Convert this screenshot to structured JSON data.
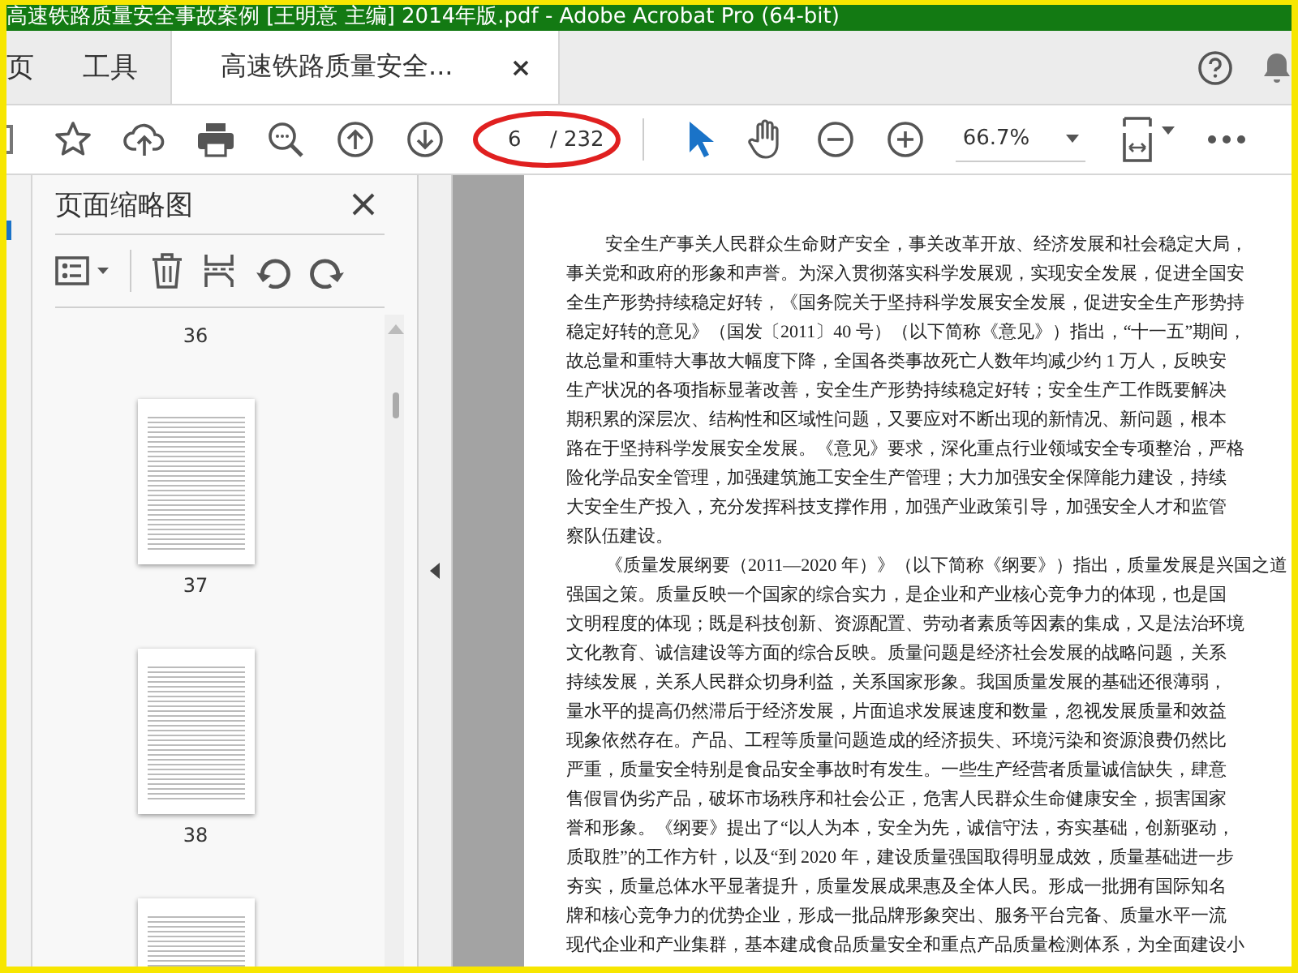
{
  "window": {
    "title": "高速铁路质量安全事故案例 [王明意 主编] 2014年版.pdf - Adobe Acrobat Pro (64-bit)"
  },
  "tabs": [
    {
      "label": "页",
      "kind": "nav",
      "selected": false
    },
    {
      "label": "工具",
      "kind": "nav",
      "selected": false
    },
    {
      "label": "高速铁路质量安全...",
      "kind": "document",
      "selected": true
    }
  ],
  "toolbar": {
    "page_field": {
      "value": "6",
      "total": "/ 232"
    },
    "tools": [
      {
        "kind": "select",
        "selected": true
      },
      {
        "kind": "hand",
        "selected": false
      }
    ],
    "zoom": {
      "value": "66.7%"
    }
  },
  "sidebar": {
    "title": "页面缩略图",
    "thumbnails": [
      {
        "label": "36"
      },
      {
        "label": "37"
      },
      {
        "label": "38"
      }
    ]
  },
  "document": {
    "paragraphs": [
      {
        "lines": [
          "安全生产事关人民群众生命财产安全，事关改革开放、经济发展和社会稳定大局，",
          "事关党和政府的形象和声誉。为深入贯彻落实科学发展观，实现安全发展，促进全国安",
          "全生产形势持续稳定好转，《国务院关于坚持科学发展安全发展，促进安全生产形势持",
          "稳定好转的意见》（国发〔2011〕40 号）（以下简称《意见》）指出，“十一五”期间，",
          "故总量和重特大事故大幅度下降，全国各类事故死亡人数年均减少约 1 万人，反映安",
          "生产状况的各项指标显著改善，安全生产形势持续稳定好转；安全生产工作既要解决",
          "期积累的深层次、结构性和区域性问题，又要应对不断出现的新情况、新问题，根本",
          "路在于坚持科学发展安全发展。《意见》要求，深化重点行业领域安全专项整治，严格",
          "险化学品安全管理，加强建筑施工安全生产管理；大力加强安全保障能力建设，持续",
          "大安全生产投入，充分发挥科技支撑作用，加强产业政策引导，加强安全人才和监管",
          "察队伍建设。"
        ]
      },
      {
        "lines": [
          "《质量发展纲要（2011—2020 年）》（以下简称《纲要》）指出，质量发展是兴国之道",
          "强国之策。质量反映一个国家的综合实力，是企业和产业核心竞争力的体现，也是国",
          "文明程度的体现；既是科技创新、资源配置、劳动者素质等因素的集成，又是法治环境",
          "文化教育、诚信建设等方面的综合反映。质量问题是经济社会发展的战略问题，关系",
          "持续发展，关系人民群众切身利益，关系国家形象。我国质量发展的基础还很薄弱，",
          "量水平的提高仍然滞后于经济发展，片面追求发展速度和数量，忽视发展质量和效益",
          "现象依然存在。产品、工程等质量问题造成的经济损失、环境污染和资源浪费仍然比",
          "严重，质量安全特别是食品安全事故时有发生。一些生产经营者质量诚信缺失，肆意",
          "售假冒伪劣产品，破坏市场秩序和社会公正，危害人民群众生命健康安全，损害国家",
          "誉和形象。《纲要》提出了“以人为本，安全为先，诚信守法，夯实基础，创新驱动，",
          "质取胜”的工作方针，以及“到 2020 年，建设质量强国取得明显成效，质量基础进一步",
          "夯实，质量总体水平显著提升，质量发展成果惠及全体人民。形成一批拥有国际知名",
          "牌和核心竞争力的优势企业，形成一批品牌形象突出、服务平台完备、质量水平一流",
          "现代企业和产业集群，基本建成食品质量安全和重点产品质量检测体系，为全面建设小"
        ]
      }
    ]
  }
}
